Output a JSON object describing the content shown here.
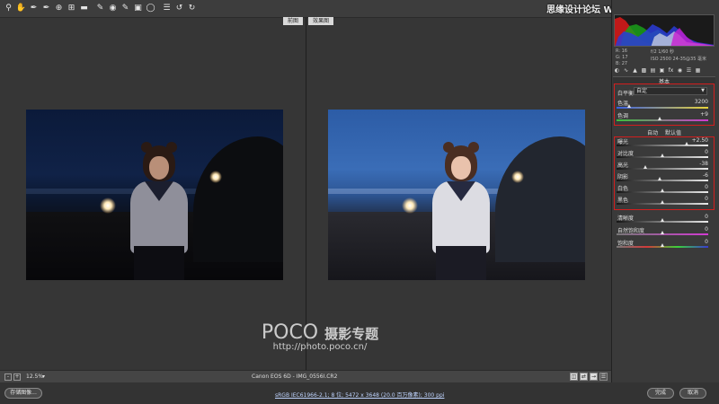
{
  "toolbar": {
    "tools": [
      "zoom-icon",
      "hand-icon",
      "white-balance-icon",
      "color-sampler-icon",
      "target-adjust-icon",
      "crop-icon",
      "straighten-icon",
      "spot-removal-icon",
      "red-eye-icon",
      "adjustment-brush-icon",
      "graduated-filter-icon",
      "radial-filter-icon",
      "rotate-ccw-icon",
      "rotate-cw-icon"
    ]
  },
  "site_watermark": "思缘设计论坛 WWW.MISSYUAN.COM",
  "preview": {
    "before_label": "前图",
    "after_label": "效果图"
  },
  "watermark": {
    "brand": "POCO",
    "brand_cn": "摄影专题",
    "url": "http://photo.poco.cn/"
  },
  "bottom_bar": {
    "zoom": "12.5%",
    "zoom_dropdown": "▾",
    "filename": "Canon EOS 6D - IMG_0556I.CR2"
  },
  "footer": {
    "save_label": "存储图像...",
    "workflow_text": "sRGB IEC61966-2.1; 8 位; 5472 x 3648 (20.0 百万像素); 300 ppi",
    "done_label": "完成",
    "cancel_label": "取消"
  },
  "camera_info": {
    "r": "R: 16",
    "g": "G: 17",
    "b": "B: 27",
    "exposure": "f/2  1/60 秒",
    "iso_lens": "ISO 2500  24-35@35 毫米"
  },
  "panel": {
    "title": "基本",
    "tabs": [
      "basic-icon",
      "tone-curve-icon",
      "detail-icon",
      "hsl-icon",
      "split-toning-icon",
      "lens-icon",
      "effects-icon",
      "camera-calibration-icon",
      "presets-icon",
      "snapshots-icon"
    ],
    "white_balance_label": "白平衡",
    "white_balance_value": "自定",
    "temperature_label": "色温",
    "temperature_value": "3200",
    "tint_label": "色调",
    "tint_value": "+9",
    "auto_label": "自动",
    "default_label": "默认值",
    "exposure_label": "曝光",
    "exposure_value": "+2.50",
    "contrast_label": "对比度",
    "contrast_value": "0",
    "highlights_label": "高光",
    "highlights_value": "-38",
    "shadows_label": "阴影",
    "shadows_value": "-6",
    "whites_label": "白色",
    "whites_value": "0",
    "blacks_label": "黑色",
    "blacks_value": "0",
    "clarity_label": "清晰度",
    "clarity_value": "0",
    "vibrance_label": "自然饱和度",
    "vibrance_value": "0",
    "saturation_label": "饱和度",
    "saturation_value": "0"
  },
  "colors": {
    "highlight_box": "#d21e1e",
    "background": "#3a3a3a"
  }
}
